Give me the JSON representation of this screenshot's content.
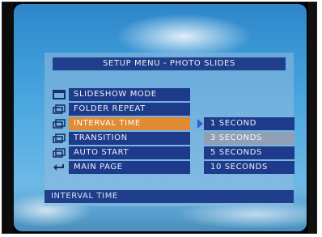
{
  "menu": {
    "title": "SETUP MENU - PHOTO SLIDES",
    "items": [
      {
        "label": "SLIDESHOW MODE",
        "icon": "window-icon"
      },
      {
        "label": "FOLDER REPEAT",
        "icon": "stacked-windows-icon"
      },
      {
        "label": "INTERVAL TIME",
        "icon": "stacked-windows-icon",
        "active": true
      },
      {
        "label": "TRANSITION",
        "icon": "stacked-windows-icon"
      },
      {
        "label": "AUTO START",
        "icon": "stacked-windows-icon"
      },
      {
        "label": "MAIN PAGE",
        "icon": "return-arrow-icon"
      }
    ],
    "options": [
      {
        "label": "1 SECOND"
      },
      {
        "label": "3 SECONDS",
        "selected": true
      },
      {
        "label": "5 SECONDS"
      },
      {
        "label": "10 SECONDS"
      }
    ],
    "status": "INTERVAL TIME"
  },
  "colors": {
    "title_bar": "#1f3f8c",
    "item_bg": "#1e3a8b",
    "active_item": "#e08a33",
    "selected_option": "#8fa0b7"
  }
}
